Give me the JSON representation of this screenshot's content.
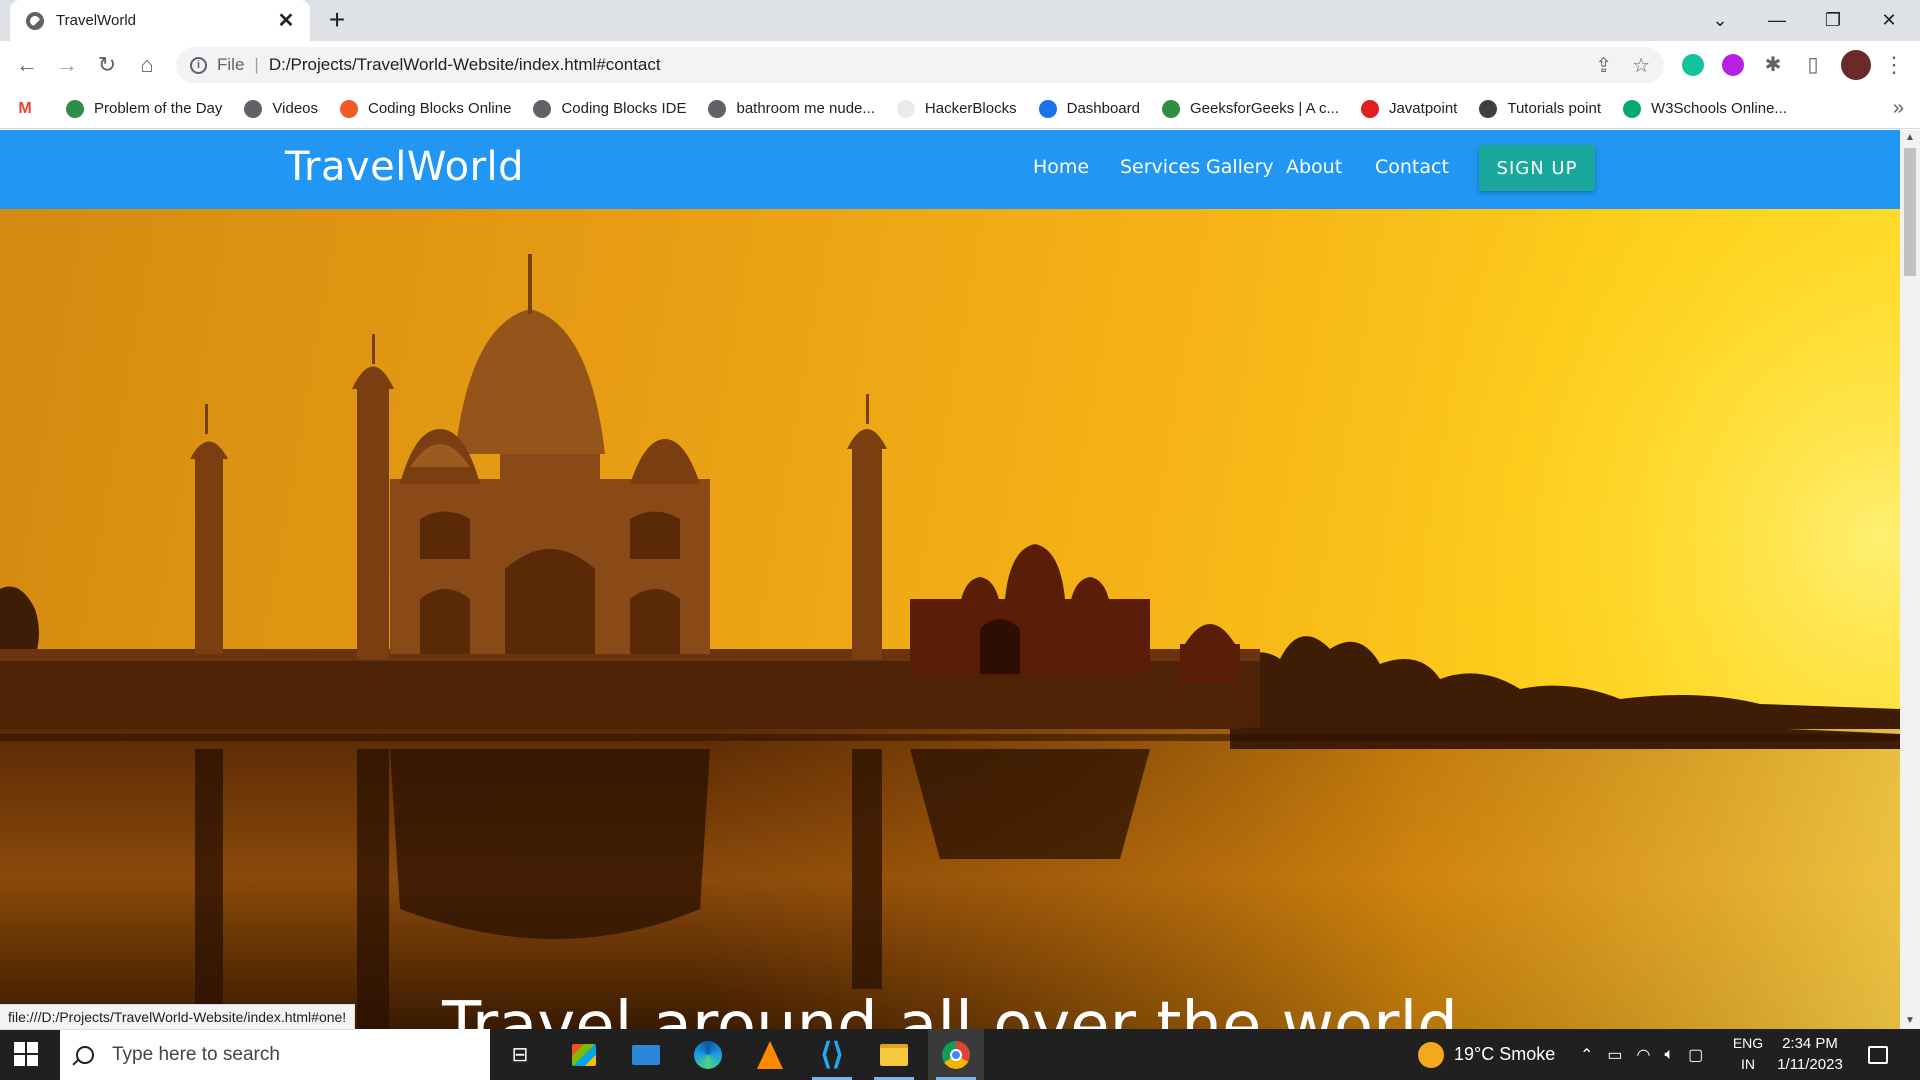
{
  "browser": {
    "tab": {
      "title": "TravelWorld"
    },
    "omnibox": {
      "scheme": "File",
      "separator": "|",
      "url": "D:/Projects/TravelWorld-Website/index.html#contact"
    },
    "bookmarks": [
      {
        "label": "Problem of the Day",
        "icon": "gfg-icon",
        "color": "#2f8d46"
      },
      {
        "label": "Videos",
        "icon": "globe-icon",
        "color": "#5f6368"
      },
      {
        "label": "Coding Blocks Online",
        "icon": "codingblocks-icon",
        "color": "#f05a28"
      },
      {
        "label": "Coding Blocks IDE",
        "icon": "globe-icon",
        "color": "#5f6368"
      },
      {
        "label": "bathroom me nude...",
        "icon": "globe-icon",
        "color": "#5f6368"
      },
      {
        "label": "HackerBlocks",
        "icon": "hackerblocks-icon",
        "color": "#e8eaed"
      },
      {
        "label": "Dashboard",
        "icon": "dashboard-icon",
        "color": "#1a73e8"
      },
      {
        "label": "GeeksforGeeks | A c...",
        "icon": "gfg-icon",
        "color": "#2f8d46"
      },
      {
        "label": "Javatpoint",
        "icon": "javatpoint-icon",
        "color": "#e02020"
      },
      {
        "label": "Tutorials point",
        "icon": "tutorialspoint-icon",
        "color": "#3c4043"
      },
      {
        "label": "W3Schools Online...",
        "icon": "w3schools-icon",
        "color": "#04aa6d"
      }
    ],
    "status_url": "file:///D:/Projects/TravelWorld-Website/index.html#one!"
  },
  "site": {
    "logo": "TravelWorld",
    "nav": {
      "home": "Home",
      "services": "Services",
      "gallery": "Gallery",
      "about": "About",
      "contact": "Contact"
    },
    "signup": "SIGN UP",
    "hero_title": "Travel around all over the world",
    "colors": {
      "nav_bg": "#2196f3",
      "signup_bg": "#1aa89c"
    }
  },
  "taskbar": {
    "search_placeholder": "Type here to search",
    "weather": "19°C  Smoke",
    "lang_top": "ENG",
    "lang_bottom": "IN",
    "time": "2:34 PM",
    "date": "1/11/2023"
  }
}
